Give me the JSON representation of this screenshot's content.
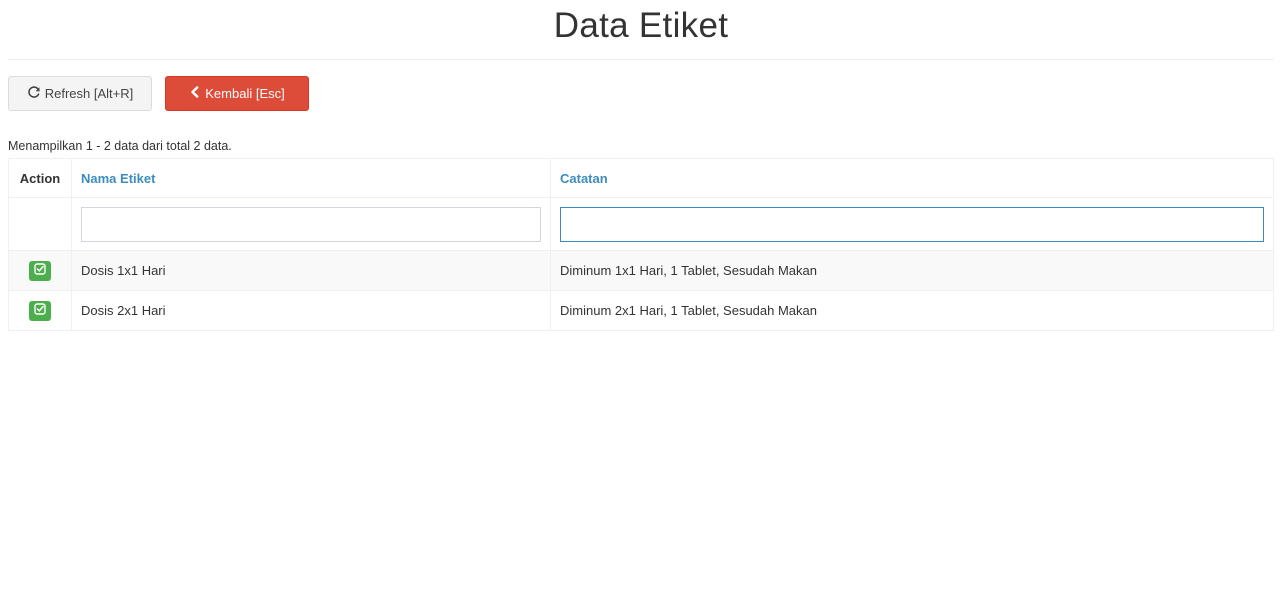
{
  "page": {
    "title": "Data Etiket"
  },
  "toolbar": {
    "refresh_label": "Refresh [Alt+R]",
    "back_label": "Kembali [Esc]"
  },
  "summary": "Menampilkan 1 - 2 data dari total 2 data.",
  "table": {
    "columns": {
      "action": "Action",
      "nama": "Nama Etiket",
      "catatan": "Catatan"
    },
    "filters": {
      "nama": "",
      "catatan": ""
    },
    "rows": [
      {
        "nama": "Dosis 1x1 Hari",
        "catatan": "Diminum 1x1 Hari, 1 Tablet, Sesudah Makan"
      },
      {
        "nama": "Dosis 2x1 Hari",
        "catatan": "Diminum 2x1 Hari, 1 Tablet, Sesudah Makan"
      }
    ]
  },
  "colors": {
    "danger": "#dd4b39",
    "success": "#4cae4c",
    "link": "#3c8dbc"
  },
  "icons": {
    "refresh": "refresh-icon",
    "back": "chevron-left-icon",
    "select": "check-square-icon"
  }
}
